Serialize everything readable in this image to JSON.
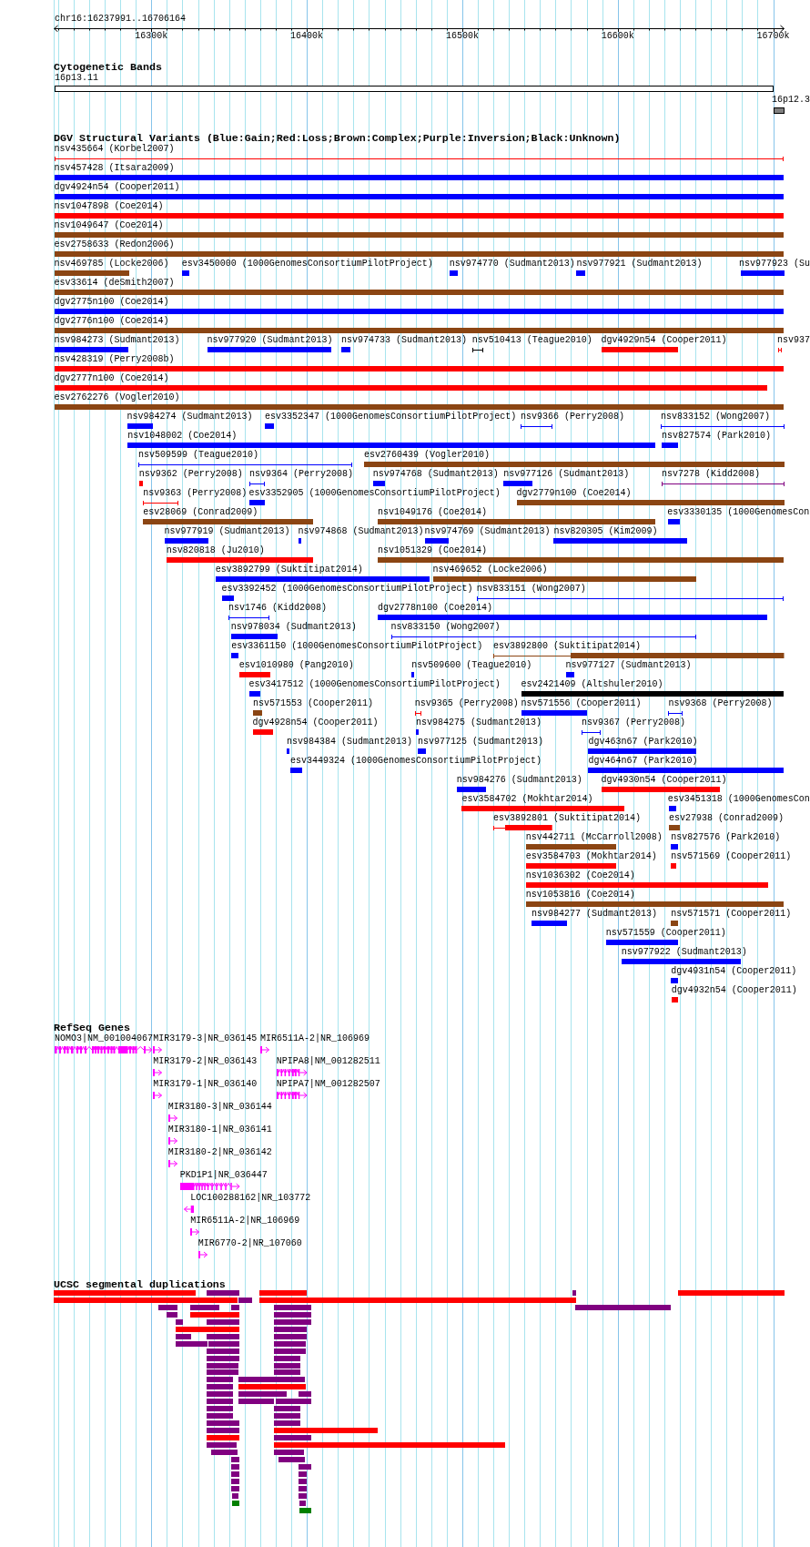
{
  "ruler": {
    "range": "chr16:16237991..16706164",
    "ticks": [
      "16300k",
      "16400k",
      "16500k",
      "16600k",
      "16700k"
    ]
  },
  "cytogenetic_bands": {
    "title": "Cytogenetic Bands",
    "bands": [
      {
        "label": "16p13.11",
        "color": "#ffffff"
      },
      {
        "label": "16p12.3",
        "color": "#808080"
      }
    ]
  },
  "dgv_variants": {
    "title": "DGV Structural Variants (Blue:Gain;Red:Loss;Brown:Complex;Purple:Inversion;Black:Unknown)",
    "features": [
      {
        "label": "nsv435664 (Korbel2007)",
        "color": "#ff0000",
        "kind": "line"
      },
      {
        "label": "nsv457428 (Itsara2009)",
        "color": "#0000ff",
        "kind": "bar"
      },
      {
        "label": "dgv4924n54 (Cooper2011)",
        "color": "#0000ff",
        "kind": "bar"
      },
      {
        "label": "nsv1047898 (Coe2014)",
        "color": "#ff0000",
        "kind": "bar"
      },
      {
        "label": "nsv1049647 (Coe2014)",
        "color": "#8b4513",
        "kind": "bar"
      },
      {
        "label": "esv2758633 (Redon2006)",
        "color": "#8b4513",
        "kind": "bar"
      },
      {
        "label": "nsv469785 (Locke2006)",
        "color": "#8b4513",
        "kind": "bar"
      },
      {
        "label": "esv3450000 (1000GenomesConsortiumPilotProject)",
        "color": "#0000ff",
        "kind": "bar"
      },
      {
        "label": "nsv974770 (Sudmant2013)",
        "color": "#0000ff",
        "kind": "bar"
      },
      {
        "label": "nsv977921 (Sudmant2013)",
        "color": "#0000ff",
        "kind": "bar"
      },
      {
        "label": "nsv977923 (Su",
        "color": "#0000ff",
        "kind": "bar"
      },
      {
        "label": "esv33614 (deSmith2007)",
        "color": "#8b4513",
        "kind": "bar"
      },
      {
        "label": "dgv2775n100 (Coe2014)",
        "color": "#0000ff",
        "kind": "bar"
      },
      {
        "label": "dgv2776n100 (Coe2014)",
        "color": "#8b4513",
        "kind": "bar"
      },
      {
        "label": "nsv984273 (Sudmant2013)",
        "color": "#0000ff",
        "kind": "bar"
      },
      {
        "label": "nsv977920 (Sudmant2013)",
        "color": "#0000ff",
        "kind": "bar"
      },
      {
        "label": "nsv974733 (Sudmant2013)",
        "color": "#0000ff",
        "kind": "bar"
      },
      {
        "label": "nsv510413 (Teague2010)",
        "color": "#000000",
        "kind": "line"
      },
      {
        "label": "dgv4929n54 (Cooper2011)",
        "color": "#ff0000",
        "kind": "bar"
      },
      {
        "label": "nsv937",
        "color": "#ff0000",
        "kind": "line"
      },
      {
        "label": "nsv428319 (Perry2008b)",
        "color": "#ff0000",
        "kind": "bar"
      },
      {
        "label": "dgv2777n100 (Coe2014)",
        "color": "#ff0000",
        "kind": "bar"
      },
      {
        "label": "esv2762276 (Vogler2010)",
        "color": "#8b4513",
        "kind": "bar"
      },
      {
        "label": "nsv984274 (Sudmant2013)",
        "color": "#0000ff",
        "kind": "bar"
      },
      {
        "label": "esv3352347 (1000GenomesConsortiumPilotProject)",
        "color": "#0000ff",
        "kind": "bar"
      },
      {
        "label": "nsv9366 (Perry2008)",
        "color": "#0000ff",
        "kind": "line"
      },
      {
        "label": "nsv833152 (Wong2007)",
        "color": "#0000ff",
        "kind": "line"
      },
      {
        "label": "nsv1048002 (Coe2014)",
        "color": "#0000ff",
        "kind": "bar"
      },
      {
        "label": "nsv827574 (Park2010)",
        "color": "#0000ff",
        "kind": "bar"
      },
      {
        "label": "nsv509599 (Teague2010)",
        "color": "#0000ff",
        "kind": "line"
      },
      {
        "label": "esv2760439 (Vogler2010)",
        "color": "#8b4513",
        "kind": "bar"
      },
      {
        "label": "nsv9362 (Perry2008)",
        "color": "#ff0000",
        "kind": "bar"
      },
      {
        "label": "nsv9364 (Perry2008)",
        "color": "#0000ff",
        "kind": "line"
      },
      {
        "label": "nsv974768 (Sudmant2013)",
        "color": "#0000ff",
        "kind": "bar"
      },
      {
        "label": "nsv977126 (Sudmant2013)",
        "color": "#0000ff",
        "kind": "bar"
      },
      {
        "label": "nsv7278 (Kidd2008)",
        "color": "#800080",
        "kind": "line"
      },
      {
        "label": "nsv9363 (Perry2008)",
        "color": "#ff0000",
        "kind": "line"
      },
      {
        "label": "esv3352905 (1000GenomesConsortiumPilotProject)",
        "color": "#0000ff",
        "kind": "bar"
      },
      {
        "label": "dgv2779n100 (Coe2014)",
        "color": "#8b4513",
        "kind": "bar"
      },
      {
        "label": "esv28069 (Conrad2009)",
        "color": "#8b4513",
        "kind": "bar"
      },
      {
        "label": "nsv1049176 (Coe2014)",
        "color": "#8b4513",
        "kind": "bar"
      },
      {
        "label": "esv3330135 (1000GenomesCon",
        "color": "#0000ff",
        "kind": "bar"
      },
      {
        "label": "nsv977919 (Sudmant2013)",
        "color": "#0000ff",
        "kind": "bar"
      },
      {
        "label": "nsv974868 (Sudmant2013)",
        "color": "#0000ff",
        "kind": "bar"
      },
      {
        "label": "nsv974769 (Sudmant2013)",
        "color": "#0000ff",
        "kind": "bar"
      },
      {
        "label": "nsv820305 (Kim2009)",
        "color": "#0000ff",
        "kind": "bar"
      },
      {
        "label": "nsv820818 (Ju2010)",
        "color": "#ff0000",
        "kind": "bar"
      },
      {
        "label": "nsv1051329 (Coe2014)",
        "color": "#8b4513",
        "kind": "bar"
      },
      {
        "label": "esv3892799 (Suktitipat2014)",
        "color": "#0000ff",
        "kind": "bar"
      },
      {
        "label": "nsv469652 (Locke2006)",
        "color": "#8b4513",
        "kind": "bar"
      },
      {
        "label": "esv3392452 (1000GenomesConsortiumPilotProject)",
        "color": "#0000ff",
        "kind": "bar"
      },
      {
        "label": "nsv833151 (Wong2007)",
        "color": "#0000ff",
        "kind": "line"
      },
      {
        "label": "nsv1746 (Kidd2008)",
        "color": "#0000ff",
        "kind": "line"
      },
      {
        "label": "dgv2778n100 (Coe2014)",
        "color": "#0000ff",
        "kind": "bar"
      },
      {
        "label": "nsv978034 (Sudmant2013)",
        "color": "#0000ff",
        "kind": "bar"
      },
      {
        "label": "nsv833150 (Wong2007)",
        "color": "#0000ff",
        "kind": "line"
      },
      {
        "label": "esv3361150 (1000GenomesConsortiumPilotProject)",
        "color": "#0000ff",
        "kind": "bar"
      },
      {
        "label": "esv3892800 (Suktitipat2014)",
        "color": "#8b4513",
        "kind": "bar"
      },
      {
        "label": "esv1010980 (Pang2010)",
        "color": "#ff0000",
        "kind": "bar"
      },
      {
        "label": "nsv509600 (Teague2010)",
        "color": "#0000ff",
        "kind": "bar"
      },
      {
        "label": "nsv977127 (Sudmant2013)",
        "color": "#0000ff",
        "kind": "bar"
      },
      {
        "label": "esv3417512 (1000GenomesConsortiumPilotProject)",
        "color": "#0000ff",
        "kind": "bar"
      },
      {
        "label": "esv2421409 (Altshuler2010)",
        "color": "#000000",
        "kind": "bar"
      },
      {
        "label": "nsv571553 (Cooper2011)",
        "color": "#8b4513",
        "kind": "bar"
      },
      {
        "label": "nsv9365 (Perry2008)",
        "color": "#ff0000",
        "kind": "line"
      },
      {
        "label": "nsv571556 (Cooper2011)",
        "color": "#0000ff",
        "kind": "bar"
      },
      {
        "label": "nsv9368 (Perry2008)",
        "color": "#0000ff",
        "kind": "line"
      },
      {
        "label": "dgv4928n54 (Cooper2011)",
        "color": "#ff0000",
        "kind": "bar"
      },
      {
        "label": "nsv984275 (Sudmant2013)",
        "color": "#0000ff",
        "kind": "bar"
      },
      {
        "label": "nsv9367 (Perry2008)",
        "color": "#0000ff",
        "kind": "line"
      },
      {
        "label": "nsv984384 (Sudmant2013)",
        "color": "#0000ff",
        "kind": "bar"
      },
      {
        "label": "nsv977125 (Sudmant2013)",
        "color": "#0000ff",
        "kind": "bar"
      },
      {
        "label": "dgv463n67 (Park2010)",
        "color": "#0000ff",
        "kind": "bar"
      },
      {
        "label": "esv3449324 (1000GenomesConsortiumPilotProject)",
        "color": "#0000ff",
        "kind": "bar"
      },
      {
        "label": "dgv464n67 (Park2010)",
        "color": "#0000ff",
        "kind": "bar"
      },
      {
        "label": "nsv984276 (Sudmant2013)",
        "color": "#0000ff",
        "kind": "bar"
      },
      {
        "label": "dgv4930n54 (Cooper2011)",
        "color": "#ff0000",
        "kind": "bar"
      },
      {
        "label": "esv3584702 (Mokhtar2014)",
        "color": "#ff0000",
        "kind": "bar"
      },
      {
        "label": "esv3451318 (1000GenomesCon",
        "color": "#0000ff",
        "kind": "bar"
      },
      {
        "label": "esv3892801 (Suktitipat2014)",
        "color": "#ff0000",
        "kind": "bar"
      },
      {
        "label": "esv27938 (Conrad2009)",
        "color": "#8b4513",
        "kind": "bar"
      },
      {
        "label": "nsv442711 (McCarroll2008)",
        "color": "#8b4513",
        "kind": "bar"
      },
      {
        "label": "nsv827576 (Park2010)",
        "color": "#0000ff",
        "kind": "bar"
      },
      {
        "label": "esv3584703 (Mokhtar2014)",
        "color": "#ff0000",
        "kind": "bar"
      },
      {
        "label": "nsv571569 (Cooper2011)",
        "color": "#ff0000",
        "kind": "bar"
      },
      {
        "label": "nsv1036302 (Coe2014)",
        "color": "#ff0000",
        "kind": "bar"
      },
      {
        "label": "nsv1053816 (Coe2014)",
        "color": "#8b4513",
        "kind": "bar"
      },
      {
        "label": "nsv984277 (Sudmant2013)",
        "color": "#0000ff",
        "kind": "bar"
      },
      {
        "label": "nsv571571 (Cooper2011)",
        "color": "#8b4513",
        "kind": "bar"
      },
      {
        "label": "nsv571559 (Cooper2011)",
        "color": "#0000ff",
        "kind": "bar"
      },
      {
        "label": "nsv977922 (Sudmant2013)",
        "color": "#0000ff",
        "kind": "bar"
      },
      {
        "label": "dgv4931n54 (Cooper2011)",
        "color": "#0000ff",
        "kind": "bar"
      },
      {
        "label": "dgv4932n54 (Cooper2011)",
        "color": "#ff0000",
        "kind": "bar"
      }
    ]
  },
  "refseq_genes": {
    "title": "RefSeq Genes",
    "genes": [
      {
        "label": "NOMO3|NM_001004067",
        "reverse": false
      },
      {
        "label": "MIR3179-3|NR_036145",
        "reverse": false
      },
      {
        "label": "MIR6511A-2|NR_106969",
        "reverse": false
      },
      {
        "label": "MIR3179-2|NR_036143",
        "reverse": false
      },
      {
        "label": "NPIPA8|NM_001282511",
        "reverse": false
      },
      {
        "label": "MIR3179-1|NR_036140",
        "reverse": false
      },
      {
        "label": "NPIPA7|NM_001282507",
        "reverse": false
      },
      {
        "label": "MIR3180-3|NR_036144",
        "reverse": false
      },
      {
        "label": "MIR3180-1|NR_036141",
        "reverse": false
      },
      {
        "label": "MIR3180-2|NR_036142",
        "reverse": false
      },
      {
        "label": "PKD1P1|NR_036447",
        "reverse": false
      },
      {
        "label": "LOC100288162|NR_103772",
        "reverse": true
      },
      {
        "label": "MIR6511A-2|NR_106969",
        "reverse": false
      },
      {
        "label": "MIR6770-2|NR_107060",
        "reverse": false
      }
    ]
  },
  "segmental_duplications": {
    "title": "UCSC segmental duplications",
    "segments": [
      {
        "color": "#ff0000"
      },
      {
        "color": "#800080"
      },
      {
        "color": "#ff0000"
      },
      {
        "color": "#800080"
      },
      {
        "color": "#ff0000"
      },
      {
        "color": "#ff0000"
      },
      {
        "color": "#800080"
      },
      {
        "color": "#ff0000"
      },
      {
        "color": "#800080"
      },
      {
        "color": "#800080"
      },
      {
        "color": "#800080"
      },
      {
        "color": "#800080"
      },
      {
        "color": "#800080"
      },
      {
        "color": "#800080"
      },
      {
        "color": "#ff0000"
      },
      {
        "color": "#800080"
      },
      {
        "color": "#800080"
      },
      {
        "color": "#800080"
      },
      {
        "color": "#800080"
      },
      {
        "color": "#ff0000"
      },
      {
        "color": "#800080"
      },
      {
        "color": "#800080"
      },
      {
        "color": "#800080"
      },
      {
        "color": "#800080"
      },
      {
        "color": "#800080"
      },
      {
        "color": "#800080"
      },
      {
        "color": "#800080"
      },
      {
        "color": "#800080"
      },
      {
        "color": "#800080"
      },
      {
        "color": "#800080"
      },
      {
        "color": "#800080"
      },
      {
        "color": "#800080"
      },
      {
        "color": "#800080"
      },
      {
        "color": "#800080"
      },
      {
        "color": "#800080"
      },
      {
        "color": "#800080"
      },
      {
        "color": "#800080"
      },
      {
        "color": "#800080"
      },
      {
        "color": "#ff0000"
      },
      {
        "color": "#800080"
      },
      {
        "color": "#800080"
      },
      {
        "color": "#800080"
      },
      {
        "color": "#800080"
      },
      {
        "color": "#800080"
      },
      {
        "color": "#800080"
      },
      {
        "color": "#800080"
      },
      {
        "color": "#800080"
      },
      {
        "color": "#800080"
      },
      {
        "color": "#800080"
      },
      {
        "color": "#800080"
      },
      {
        "color": "#800080"
      },
      {
        "color": "#800080"
      },
      {
        "color": "#ff0000"
      },
      {
        "color": "#ff0000"
      },
      {
        "color": "#800080"
      },
      {
        "color": "#800080"
      },
      {
        "color": "#ff0000"
      },
      {
        "color": "#800080"
      },
      {
        "color": "#800080"
      },
      {
        "color": "#800080"
      },
      {
        "color": "#800080"
      },
      {
        "color": "#800080"
      },
      {
        "color": "#800080"
      },
      {
        "color": "#800080"
      },
      {
        "color": "#800080"
      },
      {
        "color": "#800080"
      },
      {
        "color": "#800080"
      },
      {
        "color": "#800080"
      },
      {
        "color": "#800080"
      },
      {
        "color": "#800080"
      },
      {
        "color": "#800080"
      },
      {
        "color": "#008000"
      },
      {
        "color": "#800080"
      },
      {
        "color": "#008000"
      }
    ]
  }
}
